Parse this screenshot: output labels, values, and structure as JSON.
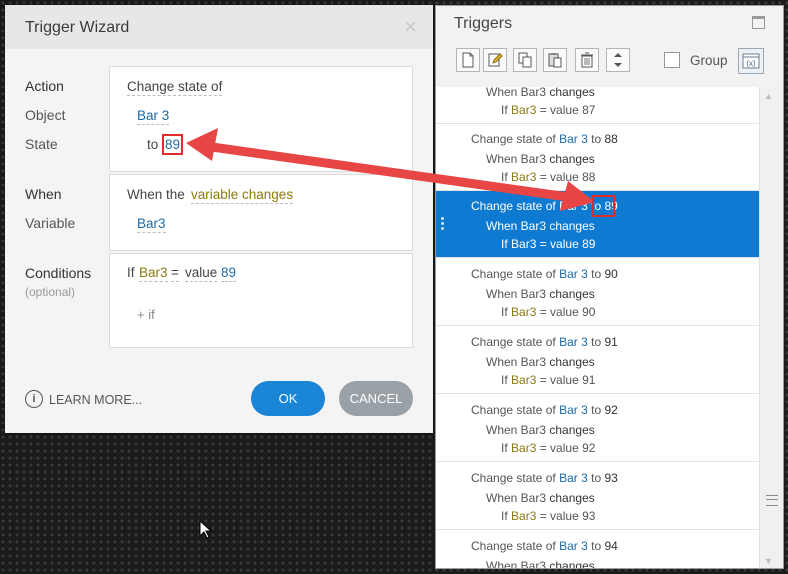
{
  "wizard": {
    "title": "Trigger Wizard",
    "close_glyph": "×",
    "labels": {
      "action": "Action",
      "object": "Object",
      "state": "State",
      "when": "When",
      "variable": "Variable",
      "conditions": "Conditions",
      "optional": "(optional)"
    },
    "action_value": "Change state of",
    "object_value": "Bar 3",
    "state_prefix": "to",
    "state_value": "89",
    "when_prefix": "When the",
    "when_value": "variable changes",
    "variable_value": "Bar3",
    "condition": {
      "prefix": "If",
      "variable": "Bar3",
      "operator": "=",
      "keyword": "value",
      "value": "89"
    },
    "add_if": "+ if",
    "learn_more": "LEARN MORE...",
    "ok_label": "OK",
    "cancel_label": "CANCEL"
  },
  "triggers_panel": {
    "title": "Triggers",
    "group_label": "Group",
    "toolbar_icons": [
      "new-trigger-icon",
      "edit-trigger-icon",
      "copy-icon",
      "paste-icon",
      "delete-icon",
      "move-up-down-icon",
      "variables-icon"
    ],
    "partial_item": {
      "when_text": "When Bar3",
      "changes": "changes",
      "if_text": "If",
      "var": "Bar3",
      "rest": "= value 87"
    },
    "items": [
      {
        "state": "88",
        "selected": false
      },
      {
        "state": "89",
        "selected": true
      },
      {
        "state": "90",
        "selected": false
      },
      {
        "state": "91",
        "selected": false
      },
      {
        "state": "92",
        "selected": false
      },
      {
        "state": "93",
        "selected": false
      },
      {
        "state": "94",
        "selected": false
      }
    ],
    "item_text": {
      "change_state_of": "Change state of",
      "object": "Bar 3",
      "to": "to",
      "when": "When Bar3",
      "changes": "changes",
      "if": "If",
      "var": "Bar3",
      "eq_value": "= value"
    }
  },
  "colors": {
    "accent_blue": "#1a84d6",
    "selected_row": "#0f7ad1",
    "annotation_red": "#e02b2b",
    "variable_olive": "#8a7a10",
    "object_blue": "#1c6aa8"
  }
}
